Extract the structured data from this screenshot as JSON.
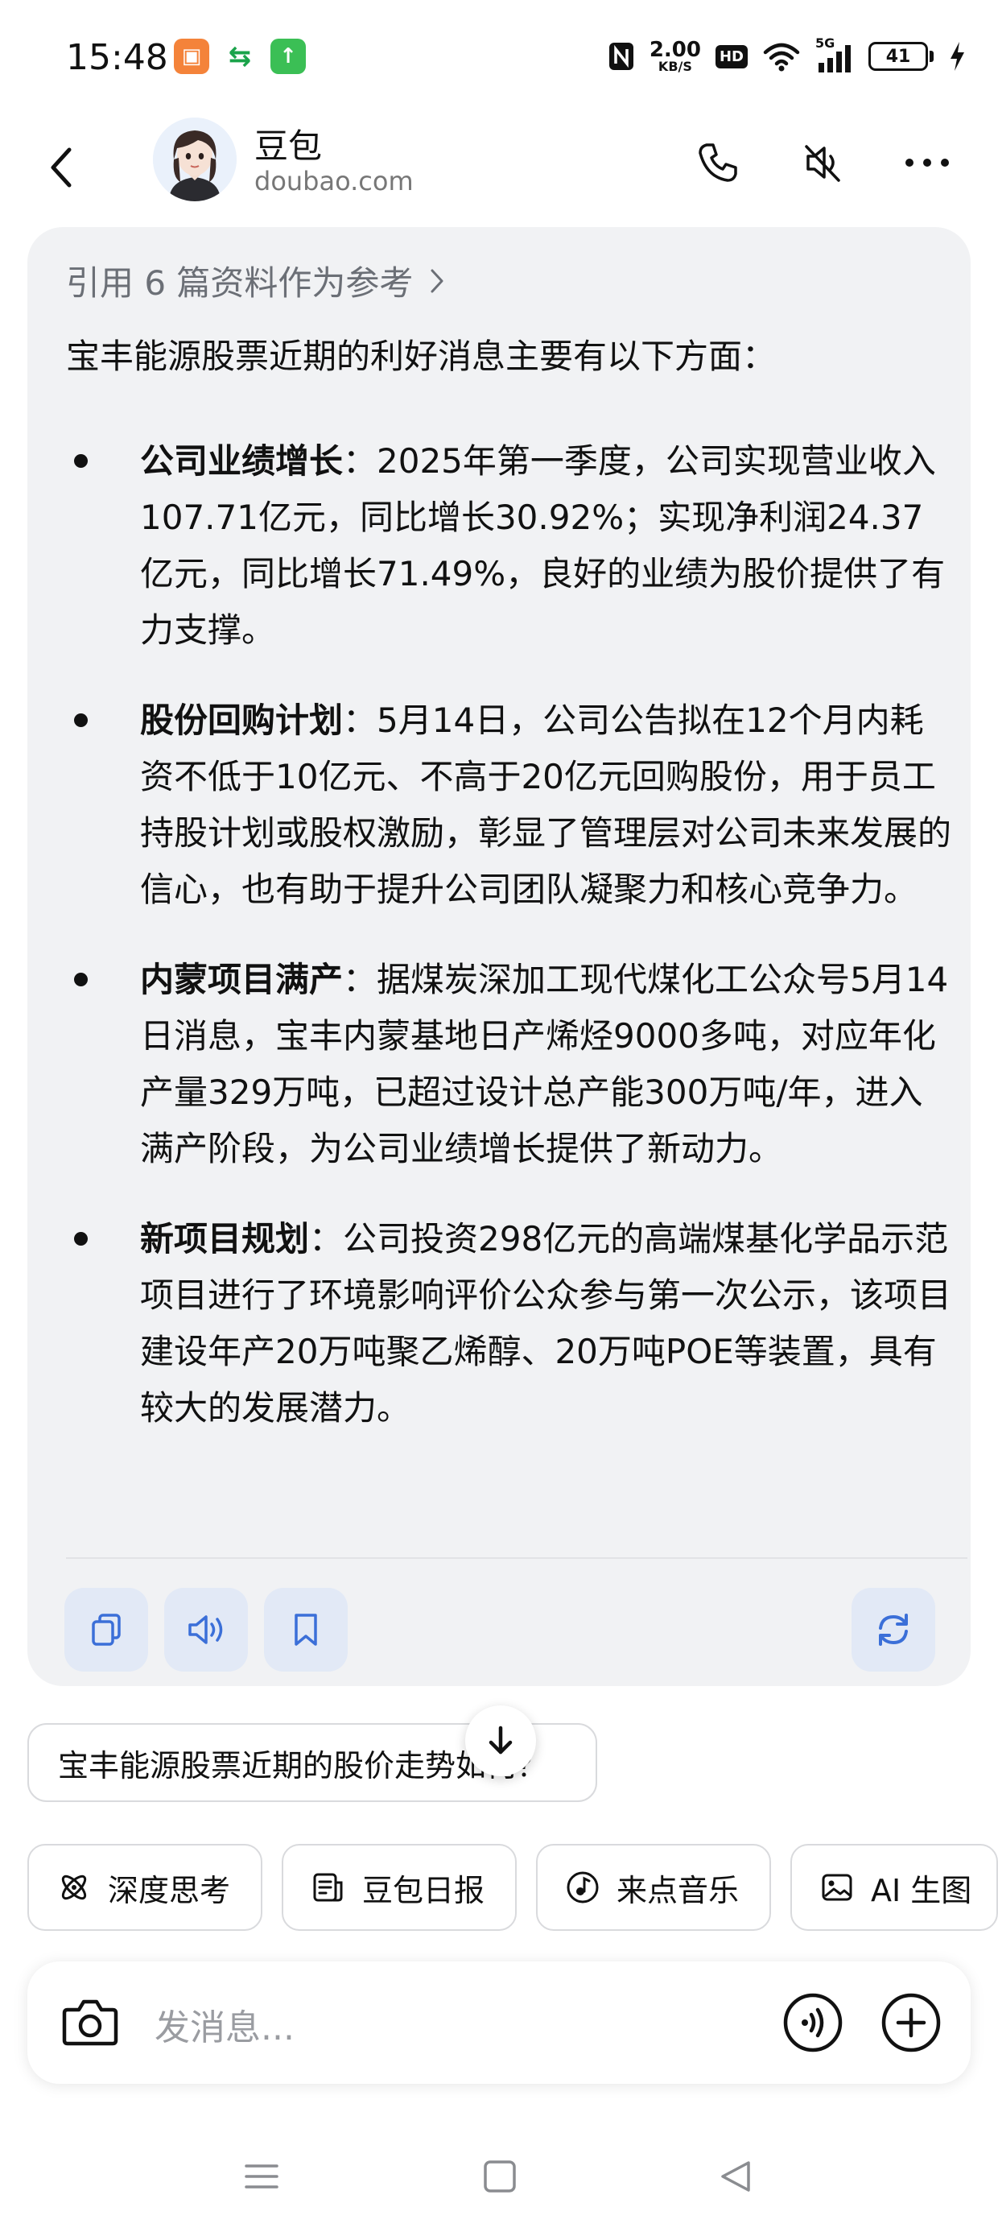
{
  "status_bar": {
    "time": "15:48",
    "net_speed_value": "2.00",
    "net_speed_unit": "KB/S",
    "hd_label": "HD",
    "signal_label": "5G",
    "battery": "41"
  },
  "header": {
    "name": "豆包",
    "domain": "doubao.com"
  },
  "message": {
    "references": "引用 6 篇资料作为参考",
    "intro": "宝丰能源股票近期的利好消息主要有以下方面：",
    "bullets": [
      {
        "title": "公司业绩增长",
        "text": "：2025年第一季度，公司实现营业收入107.71亿元，同比增长30.92%；实现净利润24.37亿元，同比增长71.49%，良好的业绩为股价提供了有力支撑。"
      },
      {
        "title": "股份回购计划",
        "text": "：5月14日，公司公告拟在12个月内耗资不低于10亿元、不高于20亿元回购股份，用于员工持股计划或股权激励，彰显了管理层对公司未来发展的信心，也有助于提升公司团队凝聚力和核心竞争力。"
      },
      {
        "title": "内蒙项目满产",
        "text": "：据煤炭深加工现代煤化工公众号5月14日消息，宝丰内蒙基地日产烯烃9000多吨，对应年化产量329万吨，已超过设计总产能300万吨/年，进入满产阶段，为公司业绩增长提供了新动力。"
      },
      {
        "title": "新项目规划",
        "text": "：公司投资298亿元的高端煤基化学品示范项目进行了环境影响评价公众参与第一次公示，该项目建设年产20万吨聚乙烯醇、20万吨POE等装置，具有较大的发展潜力。"
      }
    ]
  },
  "suggestion": "宝丰能源股票近期的股价走势如何？",
  "chips": [
    {
      "label": "深度思考",
      "icon": "atom-icon"
    },
    {
      "label": "豆包日报",
      "icon": "newspaper-icon"
    },
    {
      "label": "来点音乐",
      "icon": "music-icon"
    },
    {
      "label": "AI 生图",
      "icon": "image-icon"
    }
  ],
  "input": {
    "placeholder": "发消息..."
  },
  "colors": {
    "accent": "#3b6fd8",
    "card_bg": "#f1f2f4",
    "action_bg": "#e2e9f6"
  }
}
